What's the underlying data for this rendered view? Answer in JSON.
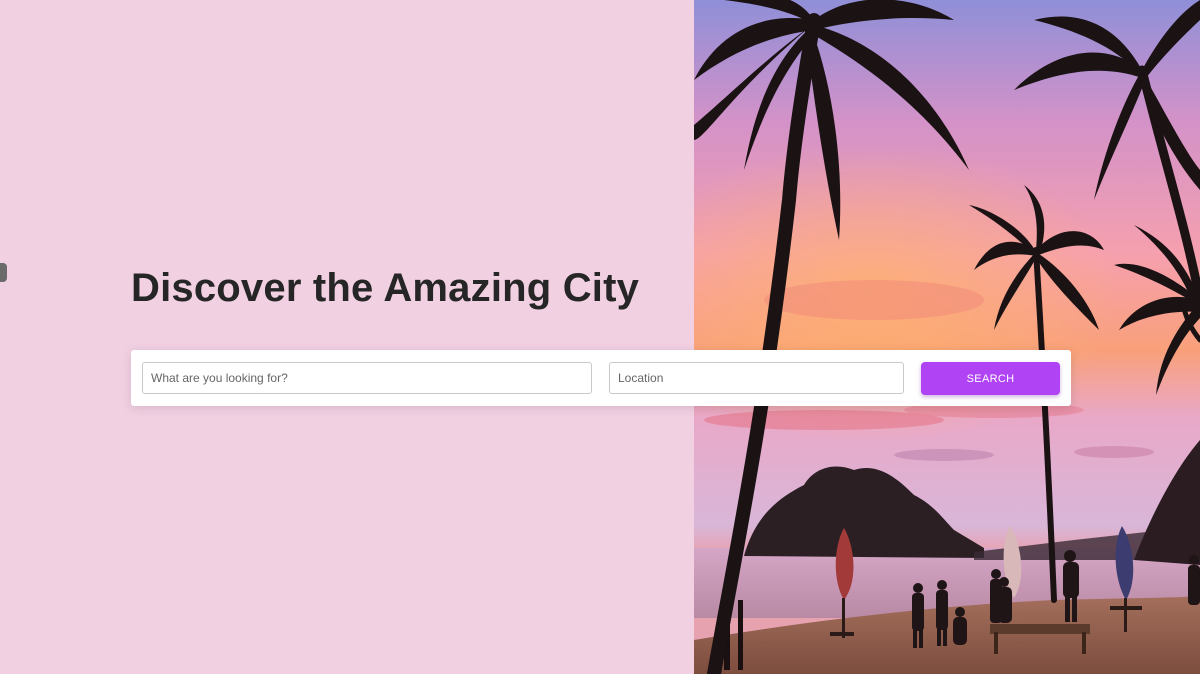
{
  "hero": {
    "title": "Discover the Amazing City"
  },
  "search": {
    "what_placeholder": "What are you looking for?",
    "location_placeholder": "Location",
    "button_label": "SEARCH"
  },
  "colors": {
    "page_background": "#f1d0e2",
    "title": "#262626",
    "button": "#b044f5"
  }
}
